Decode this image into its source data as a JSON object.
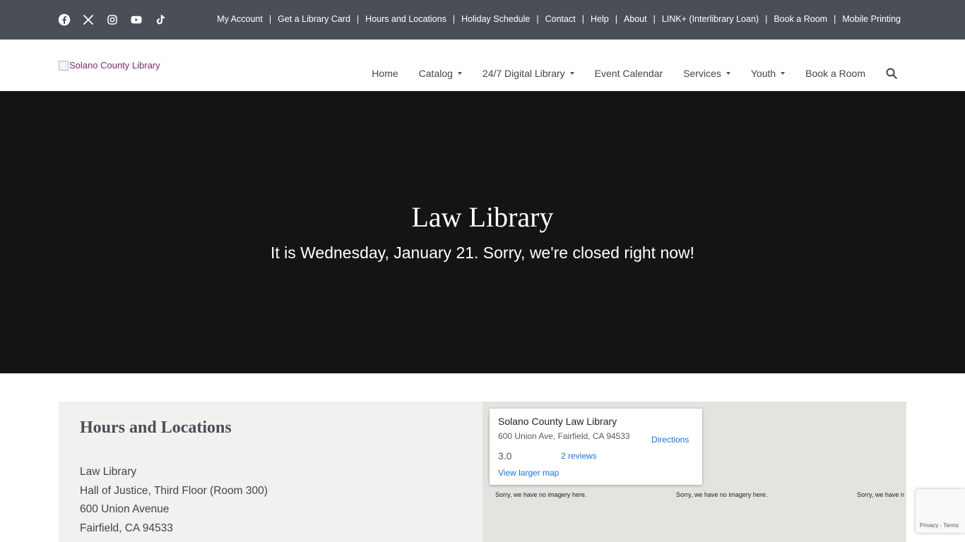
{
  "social": {
    "icons": [
      "facebook-icon",
      "x-icon",
      "instagram-icon",
      "youtube-icon",
      "tiktok-icon"
    ]
  },
  "utility_links": [
    "My Account",
    "Get a Library Card",
    "Hours and Locations",
    "Holiday Schedule",
    "Contact",
    "Help",
    "About",
    "LINK+ (Interlibrary Loan)",
    "Book a Room",
    "Mobile Printing"
  ],
  "utility_separator": "|",
  "logo": {
    "alt_text": "Solano County Library"
  },
  "nav": {
    "home": "Home",
    "catalog": "Catalog",
    "digital": "24/7 Digital Library",
    "events": "Event Calendar",
    "services": "Services",
    "youth": "Youth",
    "book_room": "Book a Room"
  },
  "hero": {
    "title": "Law Library",
    "status": "It is Wednesday, January 21. Sorry, we're closed right now!"
  },
  "hours": {
    "heading": "Hours and Locations",
    "lines": [
      "Law Library",
      "Hall of Justice, Third Floor (Room 300)",
      "600 Union Avenue",
      "Fairfield, CA 94533"
    ]
  },
  "map": {
    "place_name": "Solano County Law Library",
    "address": "600 Union Ave, Fairfield, CA 94533",
    "directions": "Directions",
    "rating": "3.0",
    "reviews": "2 reviews",
    "larger_map": "View larger map",
    "no_imagery": "Sorry, we have no imagery here.",
    "no_imagery_cut": "Sorry, we have n"
  },
  "recaptcha": {
    "privacy": "Privacy",
    "dash": " - ",
    "terms": "Terms"
  },
  "colors": {
    "topbar": "#4a4f57",
    "hero": "#141414",
    "link_blue": "#1a73e8",
    "logo_purple": "#7a2a6c",
    "panel": "#f3f1ef"
  }
}
